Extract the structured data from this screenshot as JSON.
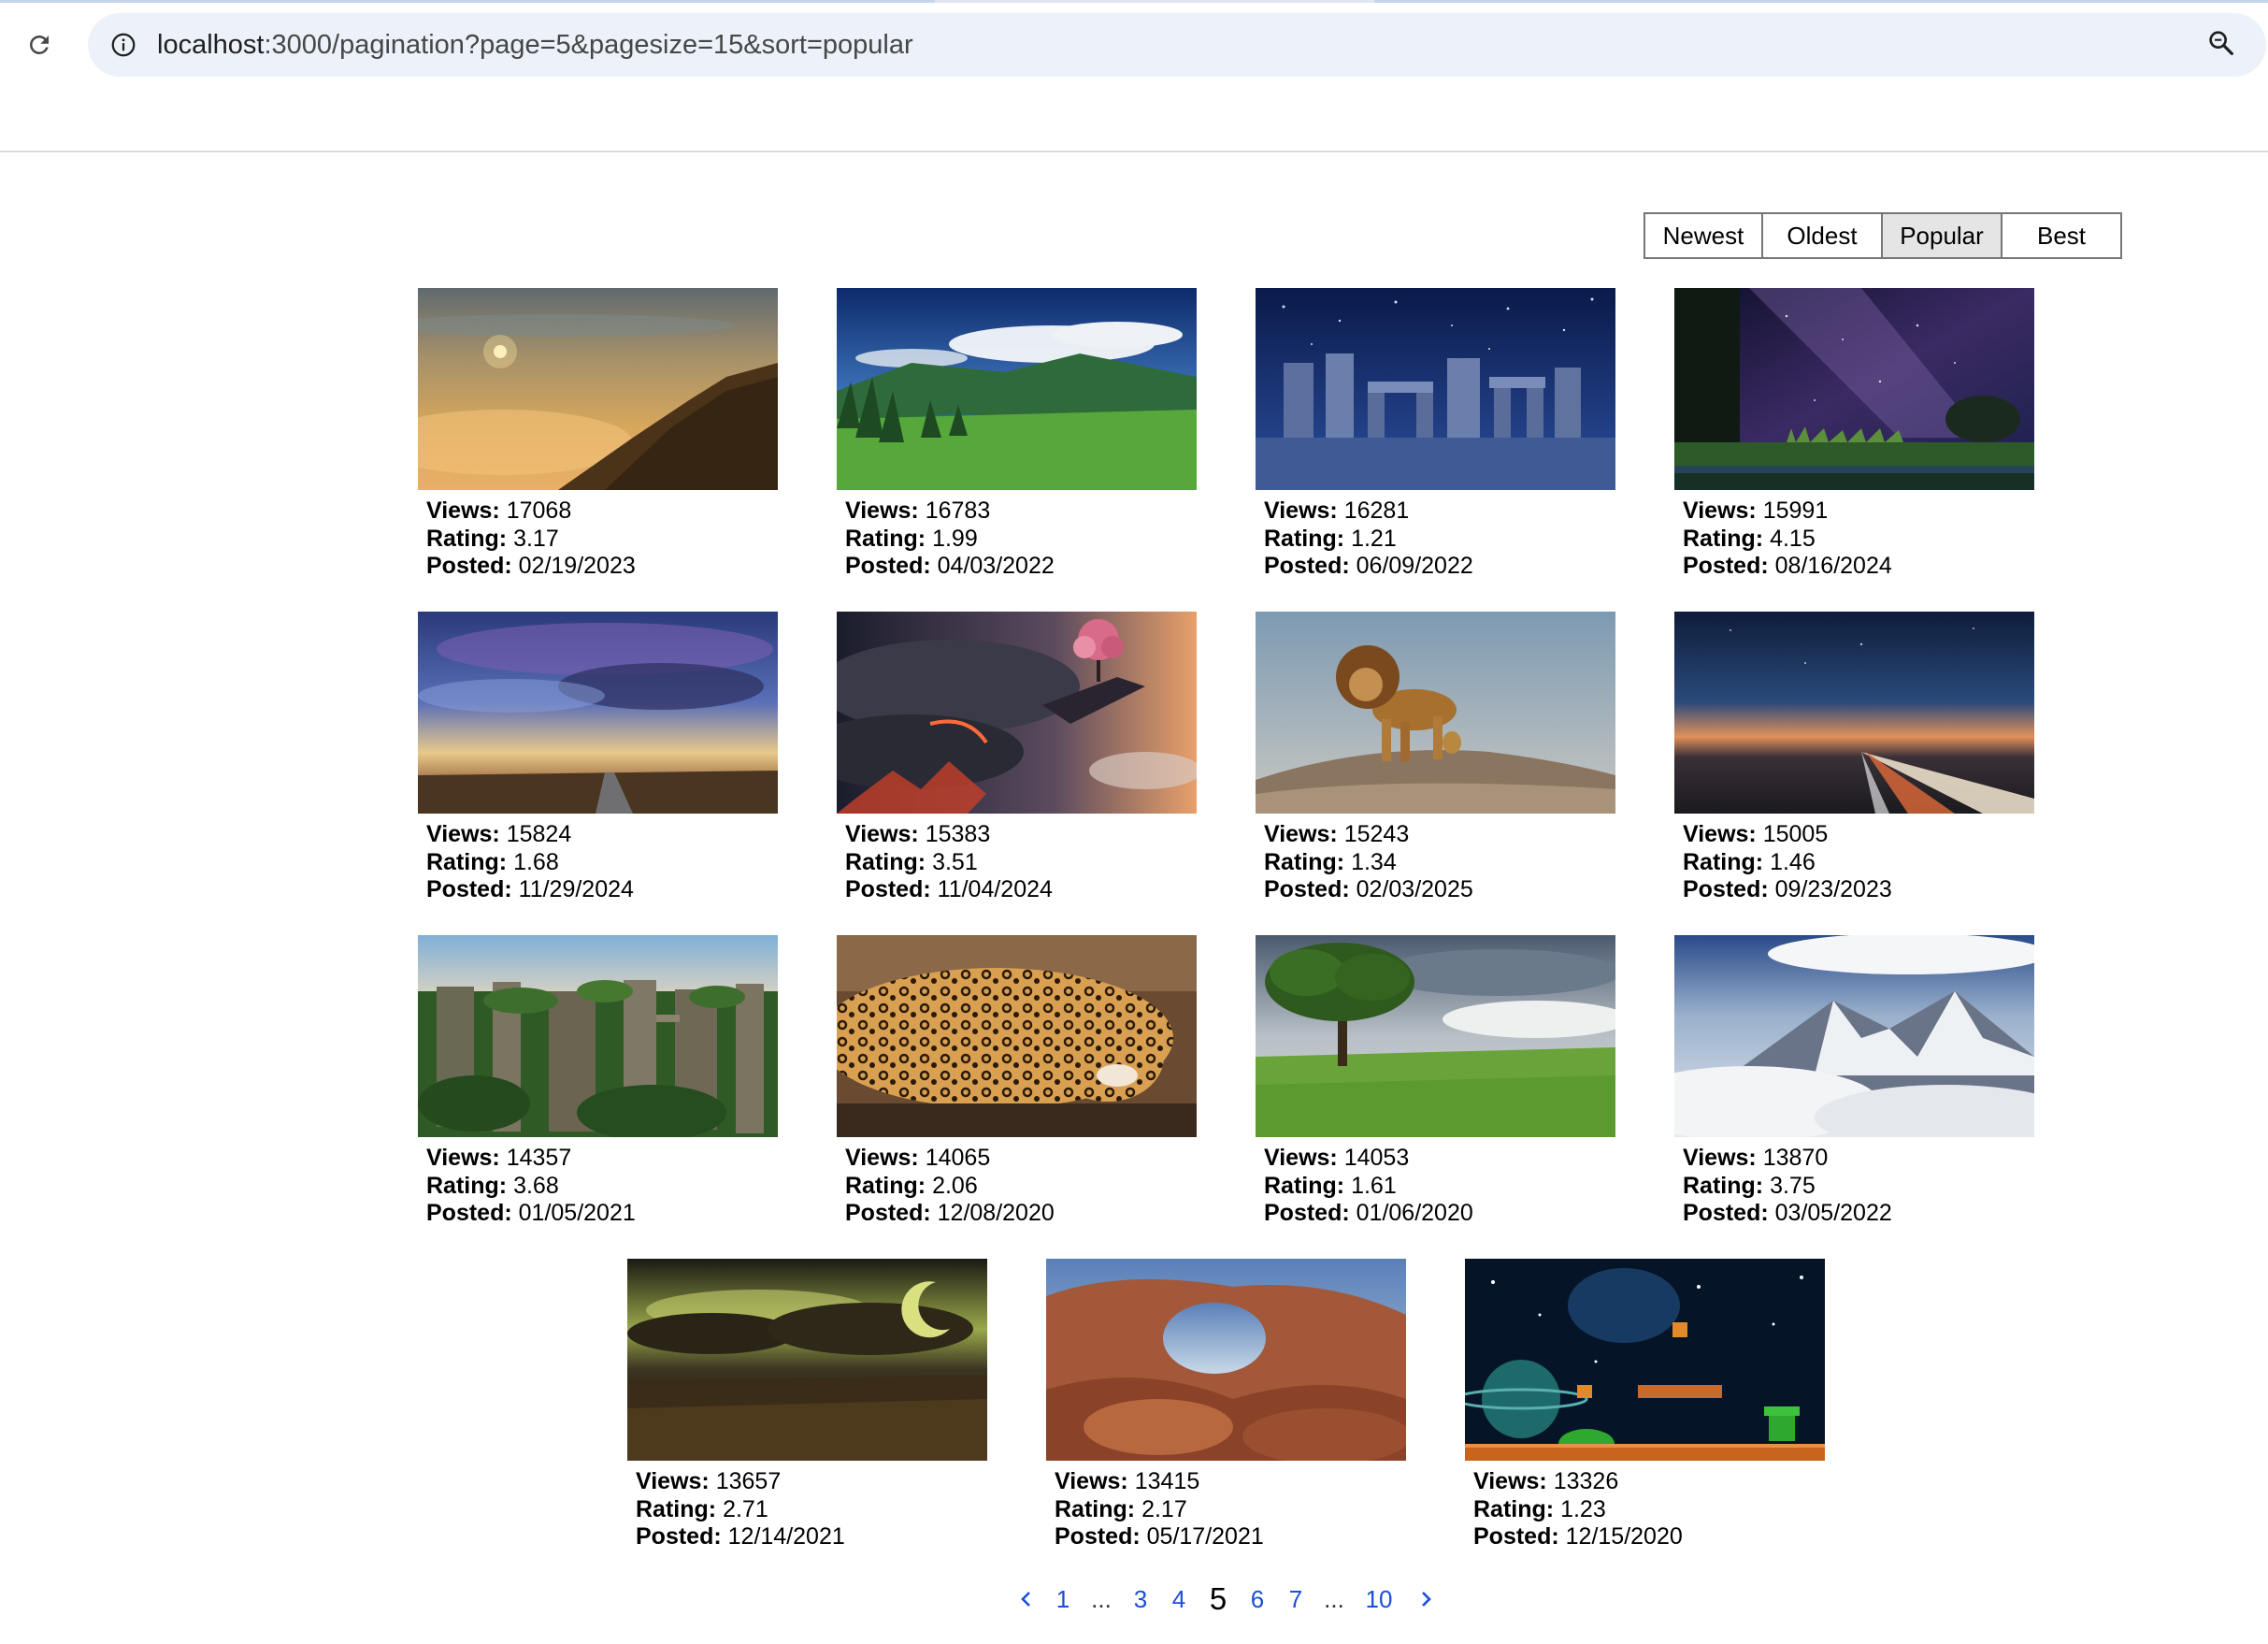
{
  "browser": {
    "url_host": "localhost",
    "url_path": ":3000/pagination?page=5&pagesize=15&sort=popular",
    "reload_icon": "reload-icon",
    "site_info_icon": "info-icon",
    "zoom_icon": "zoom-icon"
  },
  "sort": {
    "options": [
      "Newest",
      "Oldest",
      "Popular",
      "Best"
    ],
    "selected": "Popular"
  },
  "labels": {
    "views": "Views:",
    "rating": "Rating:",
    "posted": "Posted:"
  },
  "items": [
    {
      "scene": "hazy sunset hill",
      "views": "17068",
      "rating": "3.17",
      "posted": "02/19/2023"
    },
    {
      "scene": "green valley lake with clouds",
      "views": "16783",
      "rating": "1.99",
      "posted": "04/03/2022"
    },
    {
      "scene": "stonehenge at night",
      "views": "16281",
      "rating": "1.21",
      "posted": "06/09/2022"
    },
    {
      "scene": "milky way over field",
      "views": "15991",
      "rating": "4.15",
      "posted": "08/16/2024"
    },
    {
      "scene": "stormy sky over road",
      "views": "15824",
      "rating": "1.68",
      "posted": "11/29/2024"
    },
    {
      "scene": "lava cliffs with cherry tree",
      "views": "15383",
      "rating": "3.51",
      "posted": "11/04/2024"
    },
    {
      "scene": "lion on rock",
      "views": "15243",
      "rating": "1.34",
      "posted": "02/03/2025"
    },
    {
      "scene": "highway light trails at dusk",
      "views": "15005",
      "rating": "1.46",
      "posted": "09/23/2023"
    },
    {
      "scene": "sandstone rock forest",
      "views": "14357",
      "rating": "3.68",
      "posted": "01/05/2021"
    },
    {
      "scene": "sleeping leopard",
      "views": "14065",
      "rating": "2.06",
      "posted": "12/08/2020"
    },
    {
      "scene": "lone tree on grass field",
      "views": "14053",
      "rating": "1.61",
      "posted": "01/06/2020"
    },
    {
      "scene": "snowy mountains above clouds",
      "views": "13870",
      "rating": "3.75",
      "posted": "03/05/2022"
    },
    {
      "scene": "dark stormy field with moon",
      "views": "13657",
      "rating": "2.71",
      "posted": "12/14/2021"
    },
    {
      "scene": "red rock arch",
      "views": "13415",
      "rating": "2.17",
      "posted": "05/17/2021"
    },
    {
      "scene": "retro platformer game scene in space",
      "views": "13326",
      "rating": "1.23",
      "posted": "12/15/2020"
    }
  ],
  "pagination": {
    "prev_icon": "chevron-left-icon",
    "next_icon": "chevron-right-icon",
    "pages": [
      "1",
      "...",
      "3",
      "4",
      "5",
      "6",
      "7",
      "...",
      "10"
    ],
    "current": "5"
  }
}
